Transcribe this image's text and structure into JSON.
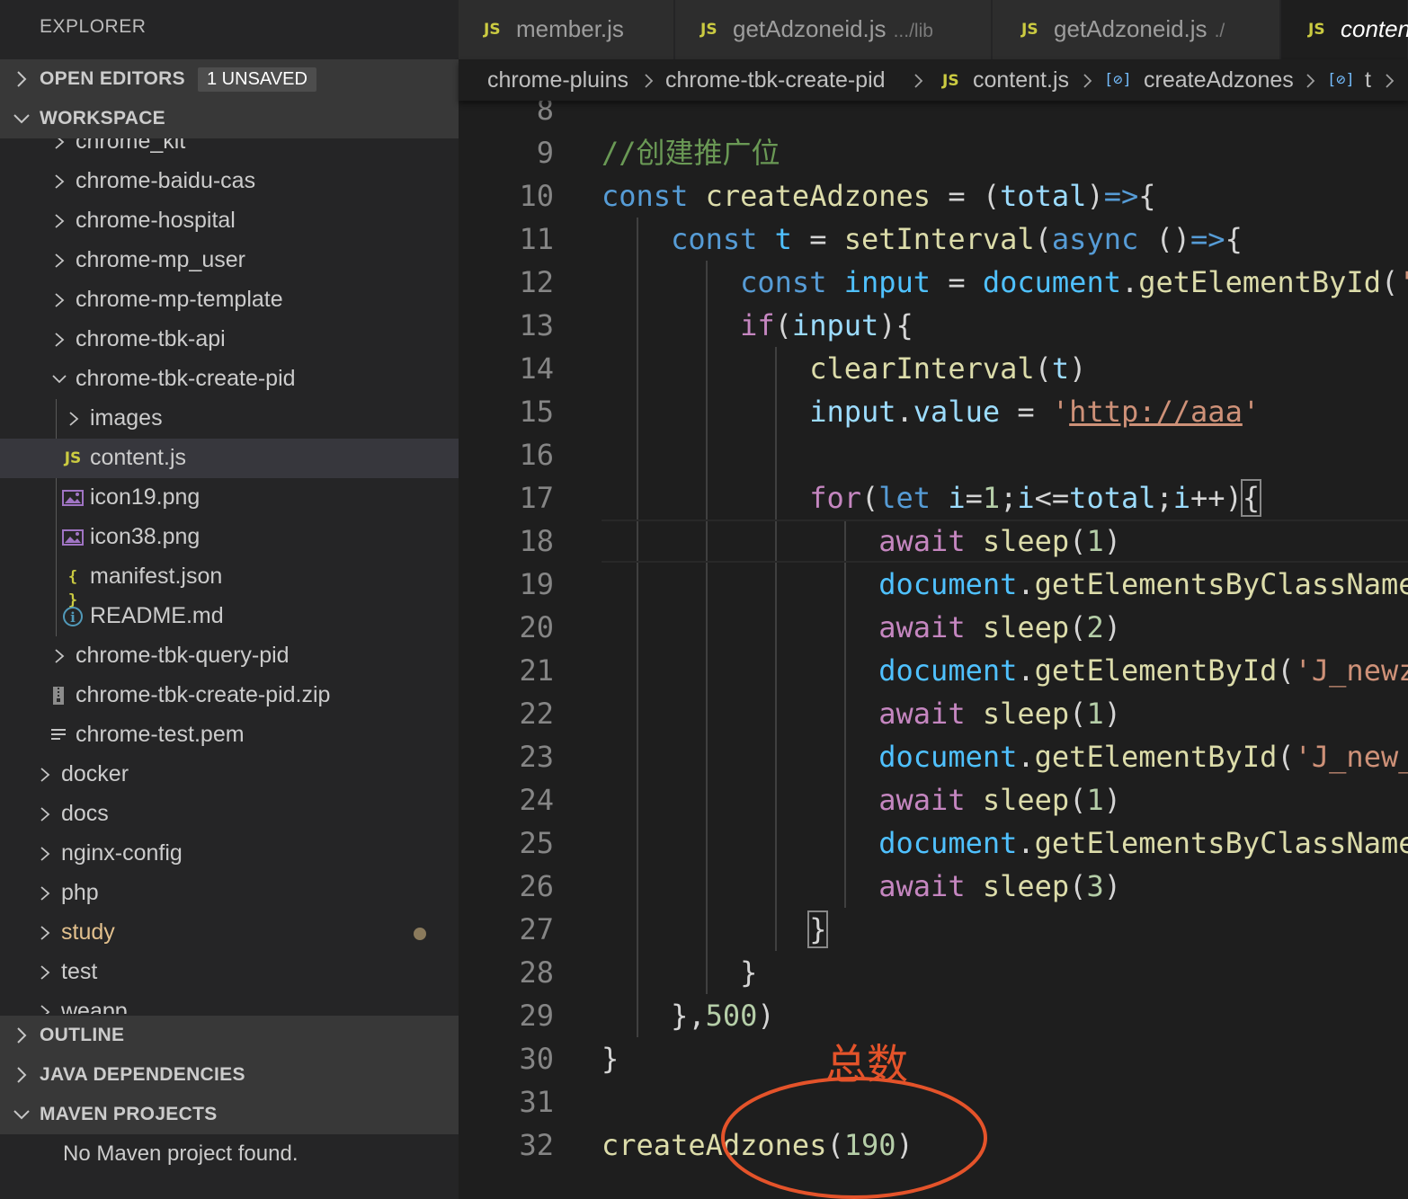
{
  "sidebar": {
    "title": "EXPLORER",
    "open_editors": {
      "label": "OPEN EDITORS",
      "badge": "1 UNSAVED"
    },
    "workspace": {
      "label": "WORKSPACE"
    },
    "tree": [
      {
        "name": "chrome_kit",
        "type": "folder",
        "expanded": false
      },
      {
        "name": "chrome-baidu-cas",
        "type": "folder",
        "expanded": false
      },
      {
        "name": "chrome-hospital",
        "type": "folder",
        "expanded": false
      },
      {
        "name": "chrome-mp_user",
        "type": "folder",
        "expanded": false
      },
      {
        "name": "chrome-mp-template",
        "type": "folder",
        "expanded": false
      },
      {
        "name": "chrome-tbk-api",
        "type": "folder",
        "expanded": false
      },
      {
        "name": "chrome-tbk-create-pid",
        "type": "folder",
        "expanded": true
      },
      {
        "name": "images",
        "type": "folder",
        "expanded": false
      },
      {
        "name": "content.js",
        "type": "js",
        "selected": true
      },
      {
        "name": "icon19.png",
        "type": "image"
      },
      {
        "name": "icon38.png",
        "type": "image"
      },
      {
        "name": "manifest.json",
        "type": "json"
      },
      {
        "name": "README.md",
        "type": "info"
      },
      {
        "name": "chrome-tbk-query-pid",
        "type": "folder",
        "expanded": false
      },
      {
        "name": "chrome-tbk-create-pid.zip",
        "type": "zip"
      },
      {
        "name": "chrome-test.pem",
        "type": "text"
      },
      {
        "name": "docker",
        "type": "folder",
        "expanded": false
      },
      {
        "name": "docs",
        "type": "folder",
        "expanded": false
      },
      {
        "name": "nginx-config",
        "type": "folder",
        "expanded": false
      },
      {
        "name": "php",
        "type": "folder",
        "expanded": false
      },
      {
        "name": "study",
        "type": "folder",
        "expanded": false,
        "modified": true
      },
      {
        "name": "test",
        "type": "folder",
        "expanded": false
      },
      {
        "name": "weapp",
        "type": "folder",
        "expanded": false
      }
    ],
    "outline": {
      "label": "OUTLINE"
    },
    "java_dependencies": {
      "label": "JAVA DEPENDENCIES"
    },
    "maven_projects": {
      "label": "MAVEN PROJECTS",
      "message": "No Maven project found."
    }
  },
  "tabs": [
    {
      "label": "member.js",
      "description": ""
    },
    {
      "label": "getAdzoneid.js",
      "description": ".../lib"
    },
    {
      "label": "getAdzoneid.js",
      "description": "./"
    },
    {
      "label": "content.js",
      "description": "",
      "active": true
    }
  ],
  "breadcrumb": [
    "chrome-pluins",
    "chrome-tbk-create-pid",
    "content.js",
    "createAdzones",
    "t"
  ],
  "file_icon_labels": {
    "js": "JS",
    "json": "{ }",
    "info": "i"
  },
  "editor": {
    "current_line": 18,
    "lines": [
      {
        "n": "8",
        "tokens": []
      },
      {
        "n": "9",
        "tokens": [
          [
            "cm",
            "//创建推广位"
          ]
        ]
      },
      {
        "n": "10",
        "tokens": [
          [
            "k",
            "const "
          ],
          [
            "f",
            "createAdzones"
          ],
          [
            "p",
            " = ("
          ],
          [
            "v",
            "total"
          ],
          [
            "p",
            ")"
          ],
          [
            "k",
            "=>"
          ],
          [
            "p",
            "{"
          ]
        ]
      },
      {
        "n": "11",
        "tokens": [
          [
            "p",
            "    "
          ],
          [
            "k",
            "const "
          ],
          [
            "cv",
            "t"
          ],
          [
            "p",
            " = "
          ],
          [
            "f",
            "setInterval"
          ],
          [
            "p",
            "("
          ],
          [
            "k",
            "async"
          ],
          [
            "p",
            " ()"
          ],
          [
            "k",
            "=>"
          ],
          [
            "p",
            "{"
          ]
        ]
      },
      {
        "n": "12",
        "tokens": [
          [
            "p",
            "        "
          ],
          [
            "k",
            "const "
          ],
          [
            "cv",
            "input"
          ],
          [
            "p",
            " = "
          ],
          [
            "cv",
            "document"
          ],
          [
            "p",
            "."
          ],
          [
            "f",
            "getElementById"
          ],
          [
            "p",
            "("
          ],
          [
            "s",
            "'"
          ]
        ]
      },
      {
        "n": "13",
        "tokens": [
          [
            "p",
            "        "
          ],
          [
            "c",
            "if"
          ],
          [
            "p",
            "("
          ],
          [
            "v",
            "input"
          ],
          [
            "p",
            "){"
          ]
        ]
      },
      {
        "n": "14",
        "tokens": [
          [
            "p",
            "            "
          ],
          [
            "f",
            "clearInterval"
          ],
          [
            "p",
            "("
          ],
          [
            "v",
            "t"
          ],
          [
            "p",
            ")"
          ]
        ]
      },
      {
        "n": "15",
        "tokens": [
          [
            "p",
            "            "
          ],
          [
            "v",
            "input"
          ],
          [
            "p",
            "."
          ],
          [
            "v",
            "value"
          ],
          [
            "p",
            " = "
          ],
          [
            "s",
            "'"
          ],
          [
            "su",
            "http://aaa"
          ],
          [
            "s",
            "'"
          ]
        ]
      },
      {
        "n": "16",
        "tokens": []
      },
      {
        "n": "17",
        "tokens": [
          [
            "p",
            "            "
          ],
          [
            "c",
            "for"
          ],
          [
            "p",
            "("
          ],
          [
            "k",
            "let "
          ],
          [
            "v",
            "i"
          ],
          [
            "p",
            "="
          ],
          [
            "n",
            "1"
          ],
          [
            "p",
            ";"
          ],
          [
            "v",
            "i"
          ],
          [
            "p",
            "<="
          ],
          [
            "v",
            "total"
          ],
          [
            "p",
            ";"
          ],
          [
            "v",
            "i"
          ],
          [
            "p",
            "++)"
          ],
          [
            "pb",
            "{"
          ]
        ]
      },
      {
        "n": "18",
        "tokens": [
          [
            "p",
            "                "
          ],
          [
            "c",
            "await "
          ],
          [
            "f",
            "sleep"
          ],
          [
            "p",
            "("
          ],
          [
            "n",
            "1"
          ],
          [
            "p",
            ")"
          ]
        ]
      },
      {
        "n": "19",
        "tokens": [
          [
            "p",
            "                "
          ],
          [
            "cv",
            "document"
          ],
          [
            "p",
            "."
          ],
          [
            "f",
            "getElementsByClassName"
          ]
        ]
      },
      {
        "n": "20",
        "tokens": [
          [
            "p",
            "                "
          ],
          [
            "c",
            "await "
          ],
          [
            "f",
            "sleep"
          ],
          [
            "p",
            "("
          ],
          [
            "n",
            "2"
          ],
          [
            "p",
            ")"
          ]
        ]
      },
      {
        "n": "21",
        "tokens": [
          [
            "p",
            "                "
          ],
          [
            "cv",
            "document"
          ],
          [
            "p",
            "."
          ],
          [
            "f",
            "getElementById"
          ],
          [
            "p",
            "("
          ],
          [
            "s",
            "'J_newz"
          ]
        ]
      },
      {
        "n": "22",
        "tokens": [
          [
            "p",
            "                "
          ],
          [
            "c",
            "await "
          ],
          [
            "f",
            "sleep"
          ],
          [
            "p",
            "("
          ],
          [
            "n",
            "1"
          ],
          [
            "p",
            ")"
          ]
        ]
      },
      {
        "n": "23",
        "tokens": [
          [
            "p",
            "                "
          ],
          [
            "cv",
            "document"
          ],
          [
            "p",
            "."
          ],
          [
            "f",
            "getElementById"
          ],
          [
            "p",
            "("
          ],
          [
            "s",
            "'J_new_"
          ]
        ]
      },
      {
        "n": "24",
        "tokens": [
          [
            "p",
            "                "
          ],
          [
            "c",
            "await "
          ],
          [
            "f",
            "sleep"
          ],
          [
            "p",
            "("
          ],
          [
            "n",
            "1"
          ],
          [
            "p",
            ")"
          ]
        ]
      },
      {
        "n": "25",
        "tokens": [
          [
            "p",
            "                "
          ],
          [
            "cv",
            "document"
          ],
          [
            "p",
            "."
          ],
          [
            "f",
            "getElementsByClassName"
          ]
        ]
      },
      {
        "n": "26",
        "tokens": [
          [
            "p",
            "                "
          ],
          [
            "c",
            "await "
          ],
          [
            "f",
            "sleep"
          ],
          [
            "p",
            "("
          ],
          [
            "n",
            "3"
          ],
          [
            "p",
            ")"
          ]
        ]
      },
      {
        "n": "27",
        "tokens": [
          [
            "p",
            "            "
          ],
          [
            "pb",
            "}"
          ]
        ]
      },
      {
        "n": "28",
        "tokens": [
          [
            "p",
            "        }"
          ]
        ]
      },
      {
        "n": "29",
        "tokens": [
          [
            "p",
            "    },"
          ],
          [
            "n",
            "500"
          ],
          [
            "p",
            ")"
          ]
        ]
      },
      {
        "n": "30",
        "tokens": [
          [
            "p",
            "}"
          ]
        ]
      },
      {
        "n": "31",
        "tokens": []
      },
      {
        "n": "32",
        "tokens": [
          [
            "f",
            "createAdzones"
          ],
          [
            "p",
            "("
          ],
          [
            "n",
            "190"
          ],
          [
            "p",
            ")"
          ]
        ]
      }
    ]
  },
  "annotation": {
    "text": "总数",
    "color": "#e4532a"
  },
  "colors": {
    "sidebar_bg": "#252526",
    "editor_bg": "#1e1e1e",
    "selection_bg": "#37373d",
    "js_icon": "#cbcb41",
    "modified": "#e2c08d"
  }
}
